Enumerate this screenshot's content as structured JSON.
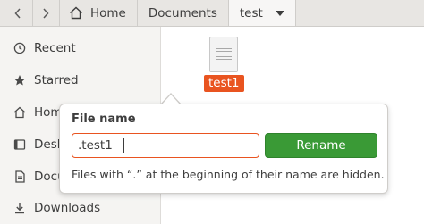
{
  "header": {
    "back_icon": "chevron-left-icon",
    "forward_icon": "chevron-right-icon",
    "breadcrumbs": [
      {
        "label": "Home",
        "icon": "home-icon"
      },
      {
        "label": "Documents"
      },
      {
        "label": "test",
        "dropdown_icon": "chevron-down-icon"
      }
    ]
  },
  "sidebar": {
    "items": [
      {
        "label": "Recent",
        "icon": "clock-icon"
      },
      {
        "label": "Starred",
        "icon": "star-icon"
      },
      {
        "label": "Home",
        "icon": "home-icon"
      },
      {
        "label": "Desktop",
        "icon": "desktop-icon"
      },
      {
        "label": "Documents",
        "icon": "document-icon"
      },
      {
        "label": "Downloads",
        "icon": "download-icon"
      }
    ]
  },
  "content": {
    "file": {
      "name": "test1",
      "icon": "text-file-icon"
    }
  },
  "rename_popover": {
    "title": "File name",
    "input_value": ".test1",
    "button_label": "Rename",
    "hint": "Files with “.” at the beginning of their name are hidden."
  },
  "colors": {
    "accent": "#e95420",
    "rename_button": "#3a9a36",
    "headerbar": "#e8e6e3",
    "sidebar": "#f5f4f2"
  }
}
